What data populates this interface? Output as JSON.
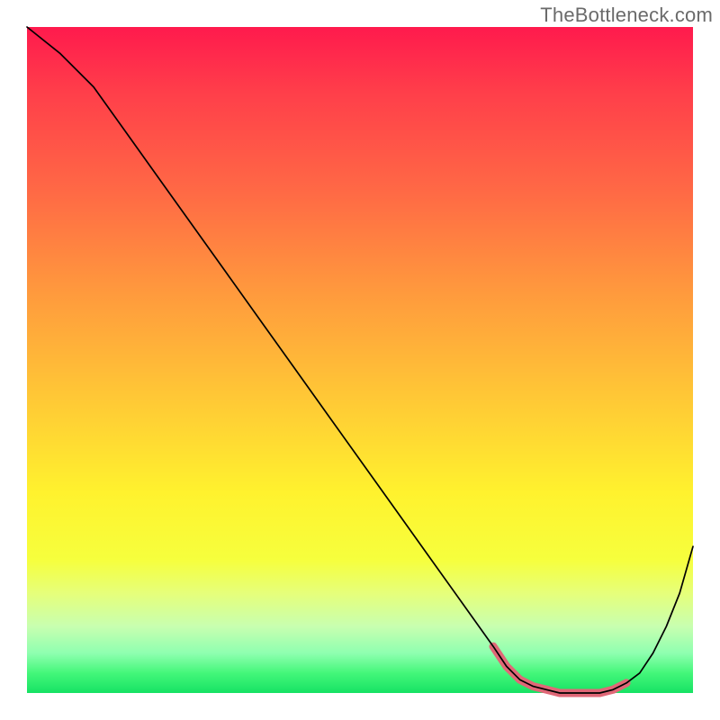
{
  "watermark": "TheBottleneck.com",
  "chart_data": {
    "type": "line",
    "title": "",
    "xlabel": "",
    "ylabel": "",
    "xlim": [
      0,
      100
    ],
    "ylim": [
      0,
      100
    ],
    "grid": false,
    "legend": false,
    "series": [
      {
        "name": "bottleneck-curve",
        "color": "#000000",
        "x": [
          0,
          5,
          10,
          15,
          20,
          25,
          30,
          35,
          40,
          45,
          50,
          55,
          60,
          65,
          70,
          72,
          74,
          76,
          78,
          80,
          82,
          84,
          86,
          88,
          90,
          92,
          94,
          96,
          98,
          100
        ],
        "y": [
          100,
          96,
          91,
          84,
          77,
          70,
          63,
          56,
          49,
          42,
          35,
          28,
          21,
          14,
          7,
          4,
          2,
          1,
          0.5,
          0,
          0,
          0,
          0,
          0.5,
          1.5,
          3,
          6,
          10,
          15,
          22
        ]
      },
      {
        "name": "sweet-spot-band",
        "color": "#e06777",
        "x": [
          70,
          72,
          74,
          76,
          78,
          80,
          82,
          84,
          86,
          88,
          90
        ],
        "y": [
          7,
          4,
          2,
          1,
          0.5,
          0,
          0,
          0,
          0,
          0.5,
          1.5
        ]
      }
    ],
    "annotations": []
  }
}
